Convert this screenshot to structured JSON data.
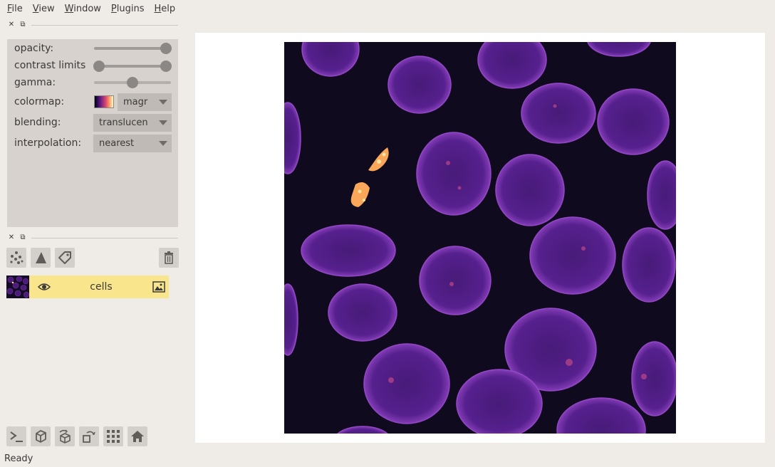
{
  "menu": [
    {
      "label": "File",
      "mnemonic": "F",
      "rest": "ile"
    },
    {
      "label": "View",
      "mnemonic": "V",
      "rest": "iew"
    },
    {
      "label": "Window",
      "mnemonic": "W",
      "rest": "indow"
    },
    {
      "label": "Plugins",
      "mnemonic": "P",
      "rest": "lugins"
    },
    {
      "label": "Help",
      "mnemonic": "H",
      "rest": "elp"
    }
  ],
  "dock": {
    "close_glyph": "✕",
    "float_glyph": "⧉"
  },
  "controls": {
    "opacity_label": "opacity:",
    "opacity_value": 1.0,
    "contrast_label": "contrast limits",
    "contrast_range": [
      0.0,
      1.0
    ],
    "gamma_label": "gamma:",
    "gamma_value": 0.5,
    "colormap_label": "colormap:",
    "colormap_value": "magr",
    "blending_label": "blending:",
    "blending_value": "translucen",
    "interpolation_label": "interpolation:",
    "interpolation_value": "nearest"
  },
  "layer_buttons": [
    "points-icon",
    "shapes-icon",
    "labels-icon",
    "delete-icon"
  ],
  "layers": [
    {
      "name": "cells",
      "visible": true,
      "type": "image"
    }
  ],
  "bottom_buttons": [
    "console-icon",
    "ndisplay-icon",
    "roll-icon",
    "transpose-icon",
    "grid-icon",
    "home-icon"
  ],
  "status": "Ready",
  "colors": {
    "background": "#efebe7",
    "panel": "#d7d2ce",
    "selected_layer": "#f8e58c",
    "canvas": "#ffffff",
    "image_bg": "#100a1e"
  }
}
